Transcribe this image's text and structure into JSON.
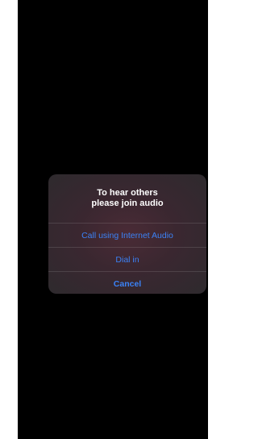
{
  "dialog": {
    "title_line1": "To hear others",
    "title_line2": "please join audio",
    "actions": [
      {
        "label": "Call using Internet Audio"
      },
      {
        "label": "Dial in"
      },
      {
        "label": "Cancel"
      }
    ]
  },
  "colors": {
    "screen_background": "#000000",
    "action_text": "#3b82f6",
    "title_text": "#ffffff"
  }
}
